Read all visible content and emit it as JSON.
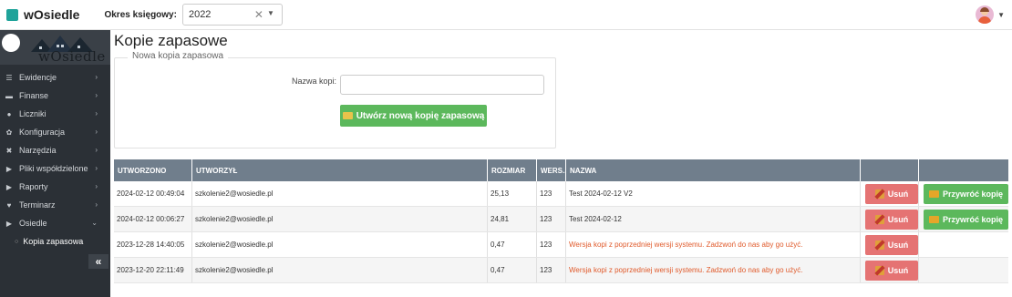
{
  "app": {
    "title": "wOsiedle"
  },
  "header": {
    "period_label": "Okres księgowy:",
    "period_value": "2022",
    "clear_glyph": "✕",
    "caret_glyph": "▼"
  },
  "sidebar": {
    "brand_text": "wOsiedle",
    "items": [
      {
        "label": "Ewidencje",
        "icon": "list-icon",
        "glyph": "☰"
      },
      {
        "label": "Finanse",
        "icon": "money-icon",
        "glyph": "▬"
      },
      {
        "label": "Liczniki",
        "icon": "gauge-icon",
        "glyph": "●"
      },
      {
        "label": "Konfiguracja",
        "icon": "gear-icon",
        "glyph": "✿"
      },
      {
        "label": "Narzędzia",
        "icon": "tools-icon",
        "glyph": "✖"
      },
      {
        "label": "Pliki współdzielone",
        "icon": "share-icon",
        "glyph": "▶"
      },
      {
        "label": "Raporty",
        "icon": "report-icon",
        "glyph": "▶"
      },
      {
        "label": "Terminarz",
        "icon": "handshake-icon",
        "glyph": "♥"
      },
      {
        "label": "Osiedle",
        "icon": "building-icon",
        "glyph": "▶"
      }
    ],
    "sub_item": "Kopia zapasowa",
    "collapse_glyph": "«",
    "chevron_glyph": "›",
    "chevron_down_glyph": "⌄"
  },
  "main": {
    "title": "Kopie zapasowe",
    "legend": "Nowa kopia zapasowa",
    "name_label": "Nazwa kopi:",
    "name_value": "",
    "create_button": "Utwórz nową kopię zapasową"
  },
  "table": {
    "headers": [
      "UTWORZONO",
      "UTWORZYŁ",
      "ROZMIAR",
      "WERS...",
      "NAZWA",
      "",
      ""
    ],
    "delete_label": "Usuń",
    "restore_label": "Przywróć kopię",
    "rows": [
      {
        "created": "2024-02-12 00:49:04",
        "by": "szkolenie2@wosiedle.pl",
        "size": "25,13",
        "version": "123",
        "name": "Test 2024-02-12 V2",
        "warn": false
      },
      {
        "created": "2024-02-12 00:06:27",
        "by": "szkolenie2@wosiedle.pl",
        "size": "24,81",
        "version": "123",
        "name": "Test 2024-02-12",
        "warn": false
      },
      {
        "created": "2023-12-28 14:40:05",
        "by": "szkolenie2@wosiedle.pl",
        "size": "0,47",
        "version": "123",
        "name": "Wersja kopi z poprzedniej wersji systemu. Zadzwoń do nas aby go użyć.",
        "warn": true
      },
      {
        "created": "2023-12-20 22:11:49",
        "by": "szkolenie2@wosiedle.pl",
        "size": "0,47",
        "version": "123",
        "name": "Wersja kopi z poprzedniej wersji systemu. Zadzwoń do nas aby go użyć.",
        "warn": true
      }
    ]
  }
}
